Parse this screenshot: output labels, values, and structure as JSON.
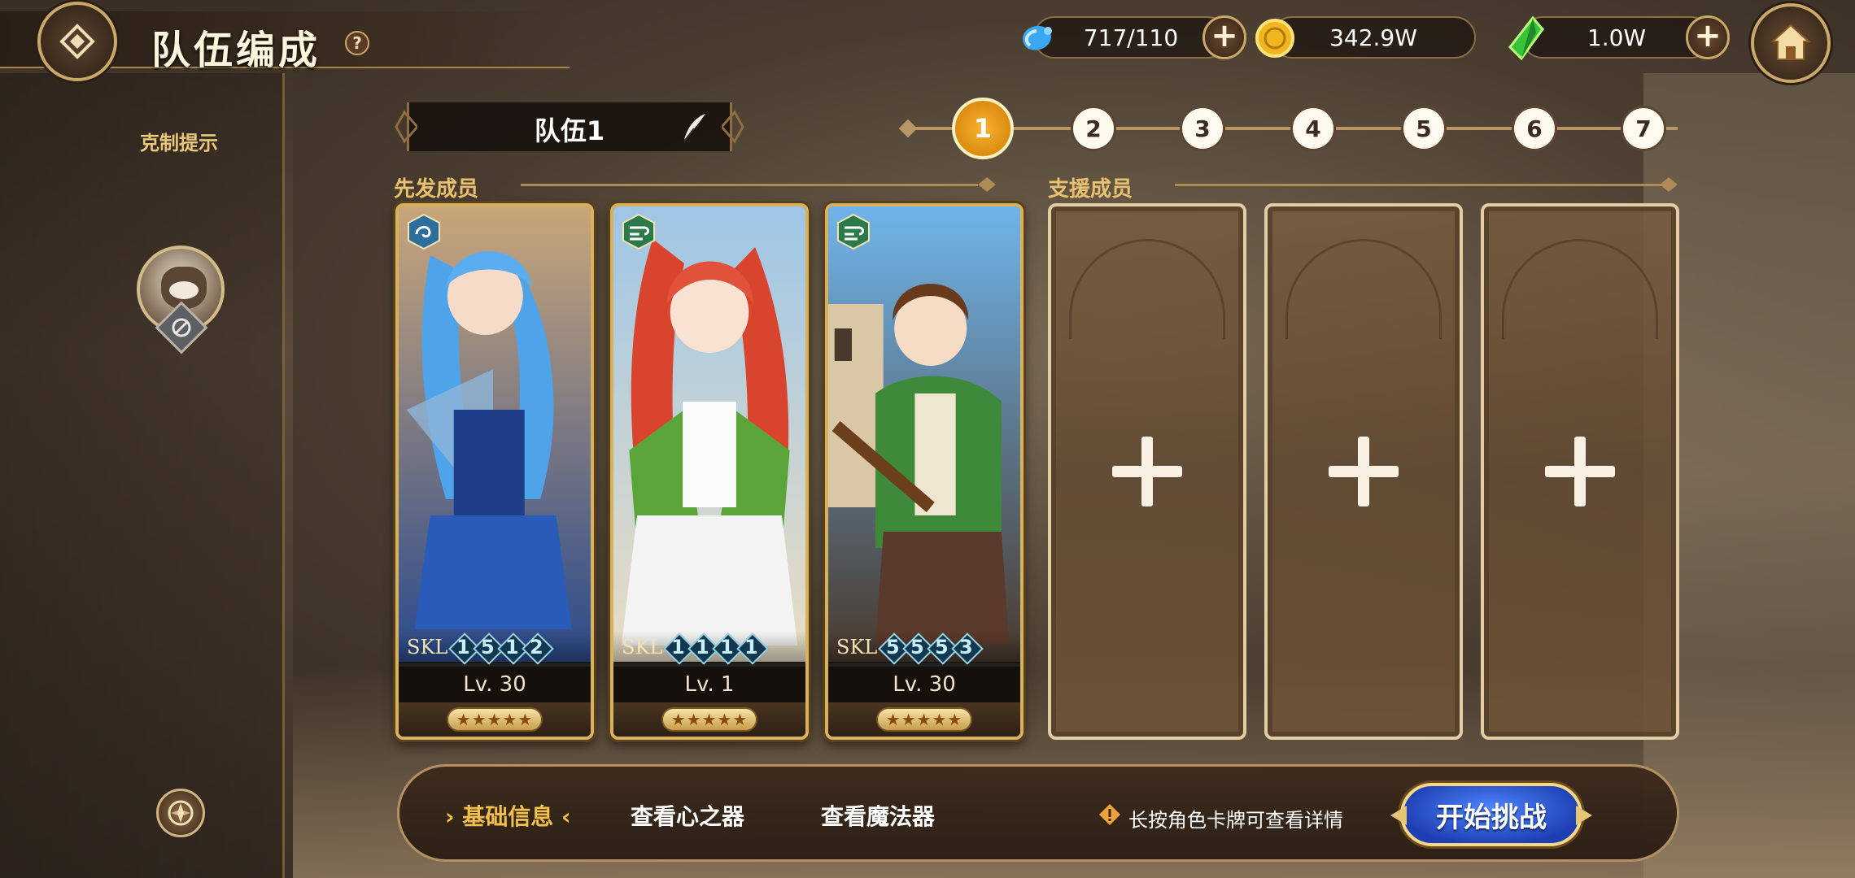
{
  "header": {
    "title": "队伍编成",
    "help": "?",
    "resources": [
      {
        "name": "stamina",
        "icon": "water-drop-icon",
        "value": "717/110"
      },
      {
        "name": "gold",
        "icon": "gold-coin-icon",
        "value": "342.9W"
      },
      {
        "name": "crystal",
        "icon": "green-crystal-icon",
        "value": "1.0W"
      }
    ]
  },
  "sidebar": {
    "counter_hint": "克制提示"
  },
  "team": {
    "name": "队伍1",
    "pages": [
      "1",
      "2",
      "3",
      "4",
      "5",
      "6",
      "7"
    ],
    "active_page": "1"
  },
  "sections": {
    "starters": "先发成员",
    "support": "支援成员"
  },
  "cards": [
    {
      "element": "water",
      "skl_label": "SKL",
      "skills": [
        "1",
        "5",
        "1",
        "2"
      ],
      "level": "Lv. 30",
      "stars": "★★★★★"
    },
    {
      "element": "wind",
      "skl_label": "SKL",
      "skills": [
        "1",
        "1",
        "1",
        "1"
      ],
      "level": "Lv. 1",
      "stars": "★★★★★"
    },
    {
      "element": "wind",
      "skl_label": "SKL",
      "skills": [
        "5",
        "5",
        "5",
        "3"
      ],
      "level": "Lv. 30",
      "stars": "★★★★★"
    }
  ],
  "bottom": {
    "tabs": [
      "基础信息",
      "查看心之器",
      "查看魔法器"
    ],
    "tip": "长按角色卡牌可查看详情",
    "start": "开始挑战"
  },
  "colors": {
    "accent_gold": "#d6b25c",
    "active_step": "#e99a1c",
    "start_button": "#2f5ee0"
  }
}
